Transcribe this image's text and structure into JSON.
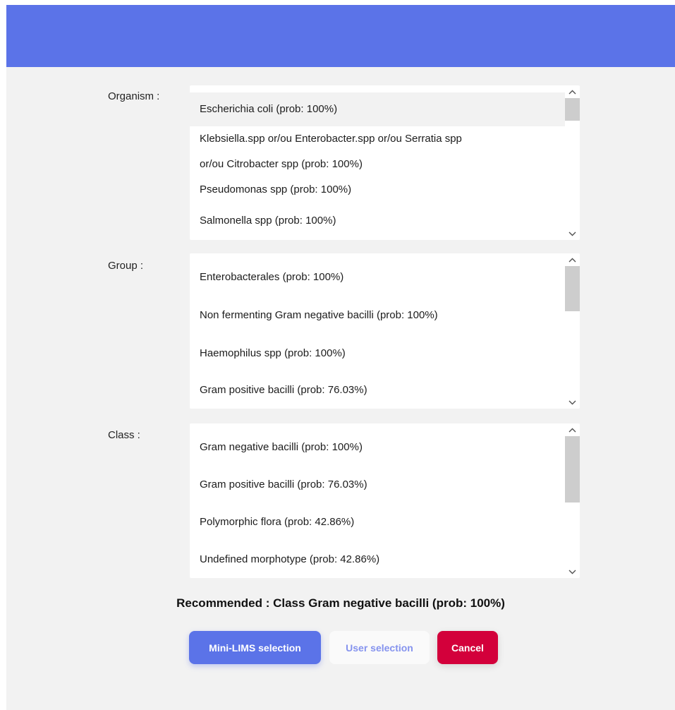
{
  "organism": {
    "label": "Organism :",
    "options": [
      "Escherichia coli (prob: 100%)",
      "Klebsiella.spp or/ou Enterobacter.spp or/ou Serratia spp",
      "or/ou Citrobacter spp (prob: 100%)",
      "Pseudomonas spp (prob: 100%)",
      "Salmonella spp (prob: 100%)"
    ],
    "selected": "Escherichia coli (prob: 100%)"
  },
  "group": {
    "label": "Group :",
    "options": [
      "Enterobacterales (prob: 100%)",
      "Non fermenting Gram negative bacilli (prob: 100%)",
      "Haemophilus spp (prob: 100%)",
      "Gram positive bacilli (prob: 76.03%)"
    ]
  },
  "class": {
    "label": "Class :",
    "options": [
      "Gram negative bacilli (prob: 100%)",
      "Gram positive bacilli (prob: 76.03%)",
      "Polymorphic flora (prob: 42.86%)",
      "Undefined morphotype (prob: 42.86%)"
    ]
  },
  "recommendation": "Recommended : Class Gram negative bacilli (prob: 100%)",
  "buttons": {
    "mini_lims": "Mini-LIMS selection",
    "user": "User selection",
    "cancel": "Cancel"
  },
  "icons": {
    "scroll_up": "chevron-up-icon",
    "scroll_down": "chevron-down-icon"
  },
  "colors": {
    "header": "#5b73e8",
    "primary_button": "#5b73e8",
    "cancel_button": "#d3003b",
    "user_button_text": "#8593ee",
    "dialog_background": "#f2f2f2"
  }
}
